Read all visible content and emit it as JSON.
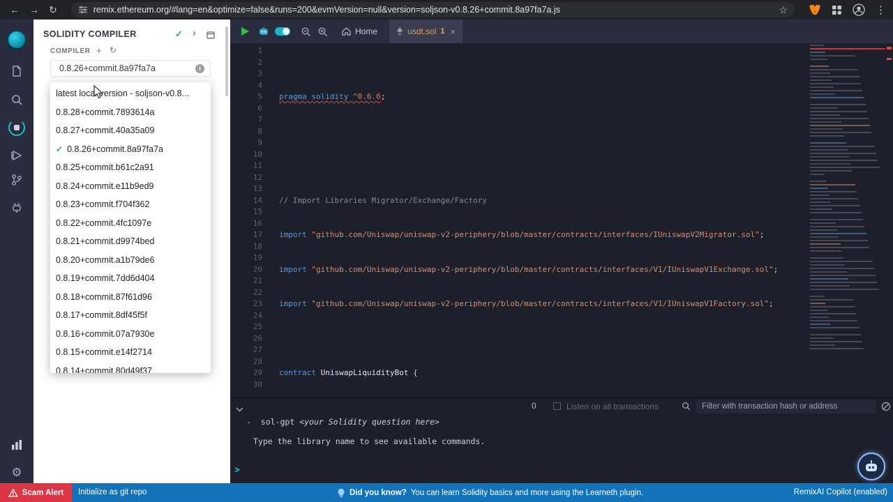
{
  "browser": {
    "url": "remix.ethereum.org/#lang=en&optimize=false&runs=200&evmVersion=null&version=soljson-v0.8.26+commit.8a97fa7a.js"
  },
  "icons": {
    "back": "←",
    "forward": "→",
    "reload": "↻",
    "star": "☆",
    "menu_dots": "⋮",
    "check": "✓",
    "chevron_right": "›",
    "plus": "+",
    "refresh": "↻",
    "close": "×",
    "settings_gear": "⚙",
    "info": "i"
  },
  "colors": {
    "statusbar_blue": "#1373b9",
    "alert_red": "#dc3545",
    "tab_modified_orange": "#df9e52",
    "terminal_prompt_teal": "#18c2c9",
    "panel_bg": "#ffffff",
    "editor_bg": "#1d1f2b",
    "rail_bg": "#2a2c3f"
  },
  "compiler_panel": {
    "title": "SOLIDITY COMPILER",
    "section": "COMPILER",
    "selected_version": "0.8.26+commit.8a97fa7a",
    "dropdown": {
      "selected_index": 3,
      "items": [
        "latest local version - soljson-v0.8...",
        "0.8.28+commit.7893614a",
        "0.8.27+commit.40a35a09",
        "0.8.26+commit.8a97fa7a",
        "0.8.25+commit.b61c2a91",
        "0.8.24+commit.e11b9ed9",
        "0.8.23+commit.f704f362",
        "0.8.22+commit.4fc1097e",
        "0.8.21+commit.d9974bed",
        "0.8.20+commit.a1b79de6",
        "0.8.19+commit.7dd6d404",
        "0.8.18+commit.87f61d96",
        "0.8.17+commit.8df45f5f",
        "0.8.16+commit.07a7930e",
        "0.8.15+commit.e14f2714",
        "0.8.14+commit.80d49f37"
      ]
    }
  },
  "editor": {
    "tabs": [
      {
        "label": "Home",
        "active": false
      },
      {
        "label": "usdt.sol",
        "badge": "1",
        "active": true
      }
    ],
    "line_count": 30,
    "lines": {
      "5": [
        {
          "t": "pragma solidity ",
          "c": "kw",
          "e": true
        },
        {
          "t": "^0.6.6",
          "c": "num",
          "e": true
        },
        {
          "t": ";",
          "c": "pln"
        }
      ],
      "14": [
        {
          "t": "// Import Libraries Migrator/Exchange/Factory",
          "c": "com"
        }
      ],
      "17": [
        {
          "t": "import ",
          "c": "kw"
        },
        {
          "t": "\"github.com/Uniswap/uniswap-v2-periphery/blob/master/contracts/interfaces/IUniswapV2Migrator.sol\"",
          "c": "str"
        },
        {
          "t": ";",
          "c": "pln"
        }
      ],
      "20": [
        {
          "t": "import ",
          "c": "kw"
        },
        {
          "t": "\"github.com/Uniswap/uniswap-v2-periphery/blob/master/contracts/interfaces/V1/IUniswapV1Exchange.sol\"",
          "c": "str"
        },
        {
          "t": ";",
          "c": "pln"
        }
      ],
      "23": [
        {
          "t": "import ",
          "c": "kw"
        },
        {
          "t": "\"github.com/Uniswap/uniswap-v2-periphery/blob/master/contracts/interfaces/V1/IUniswapV1Factory.sol\"",
          "c": "str"
        },
        {
          "t": ";",
          "c": "pln"
        }
      ],
      "29": [
        {
          "t": "contract ",
          "c": "kw"
        },
        {
          "t": "UniswapLiquidityBot ",
          "c": "typ"
        },
        {
          "t": "{",
          "c": "pln"
        }
      ]
    }
  },
  "terminal": {
    "badge": "0",
    "listen_label": "Listen on all transactions",
    "search_placeholder": "Filter with transaction hash or address",
    "entries": [
      {
        "bullet": "-",
        "prefix": "sol-gpt ",
        "italic": "<your Solidity question here>"
      },
      {
        "text": "Type the library name to see available commands."
      }
    ],
    "prompt": ">"
  },
  "statusbar": {
    "scam_alert": "Scam Alert",
    "git_label": "Initialize as git repo",
    "tip_bold": "Did you know?",
    "tip_text": "You can learn Solidity basics and more using the Learneth plugin.",
    "copilot_label": "RemixAI Copilot (enabled)"
  }
}
